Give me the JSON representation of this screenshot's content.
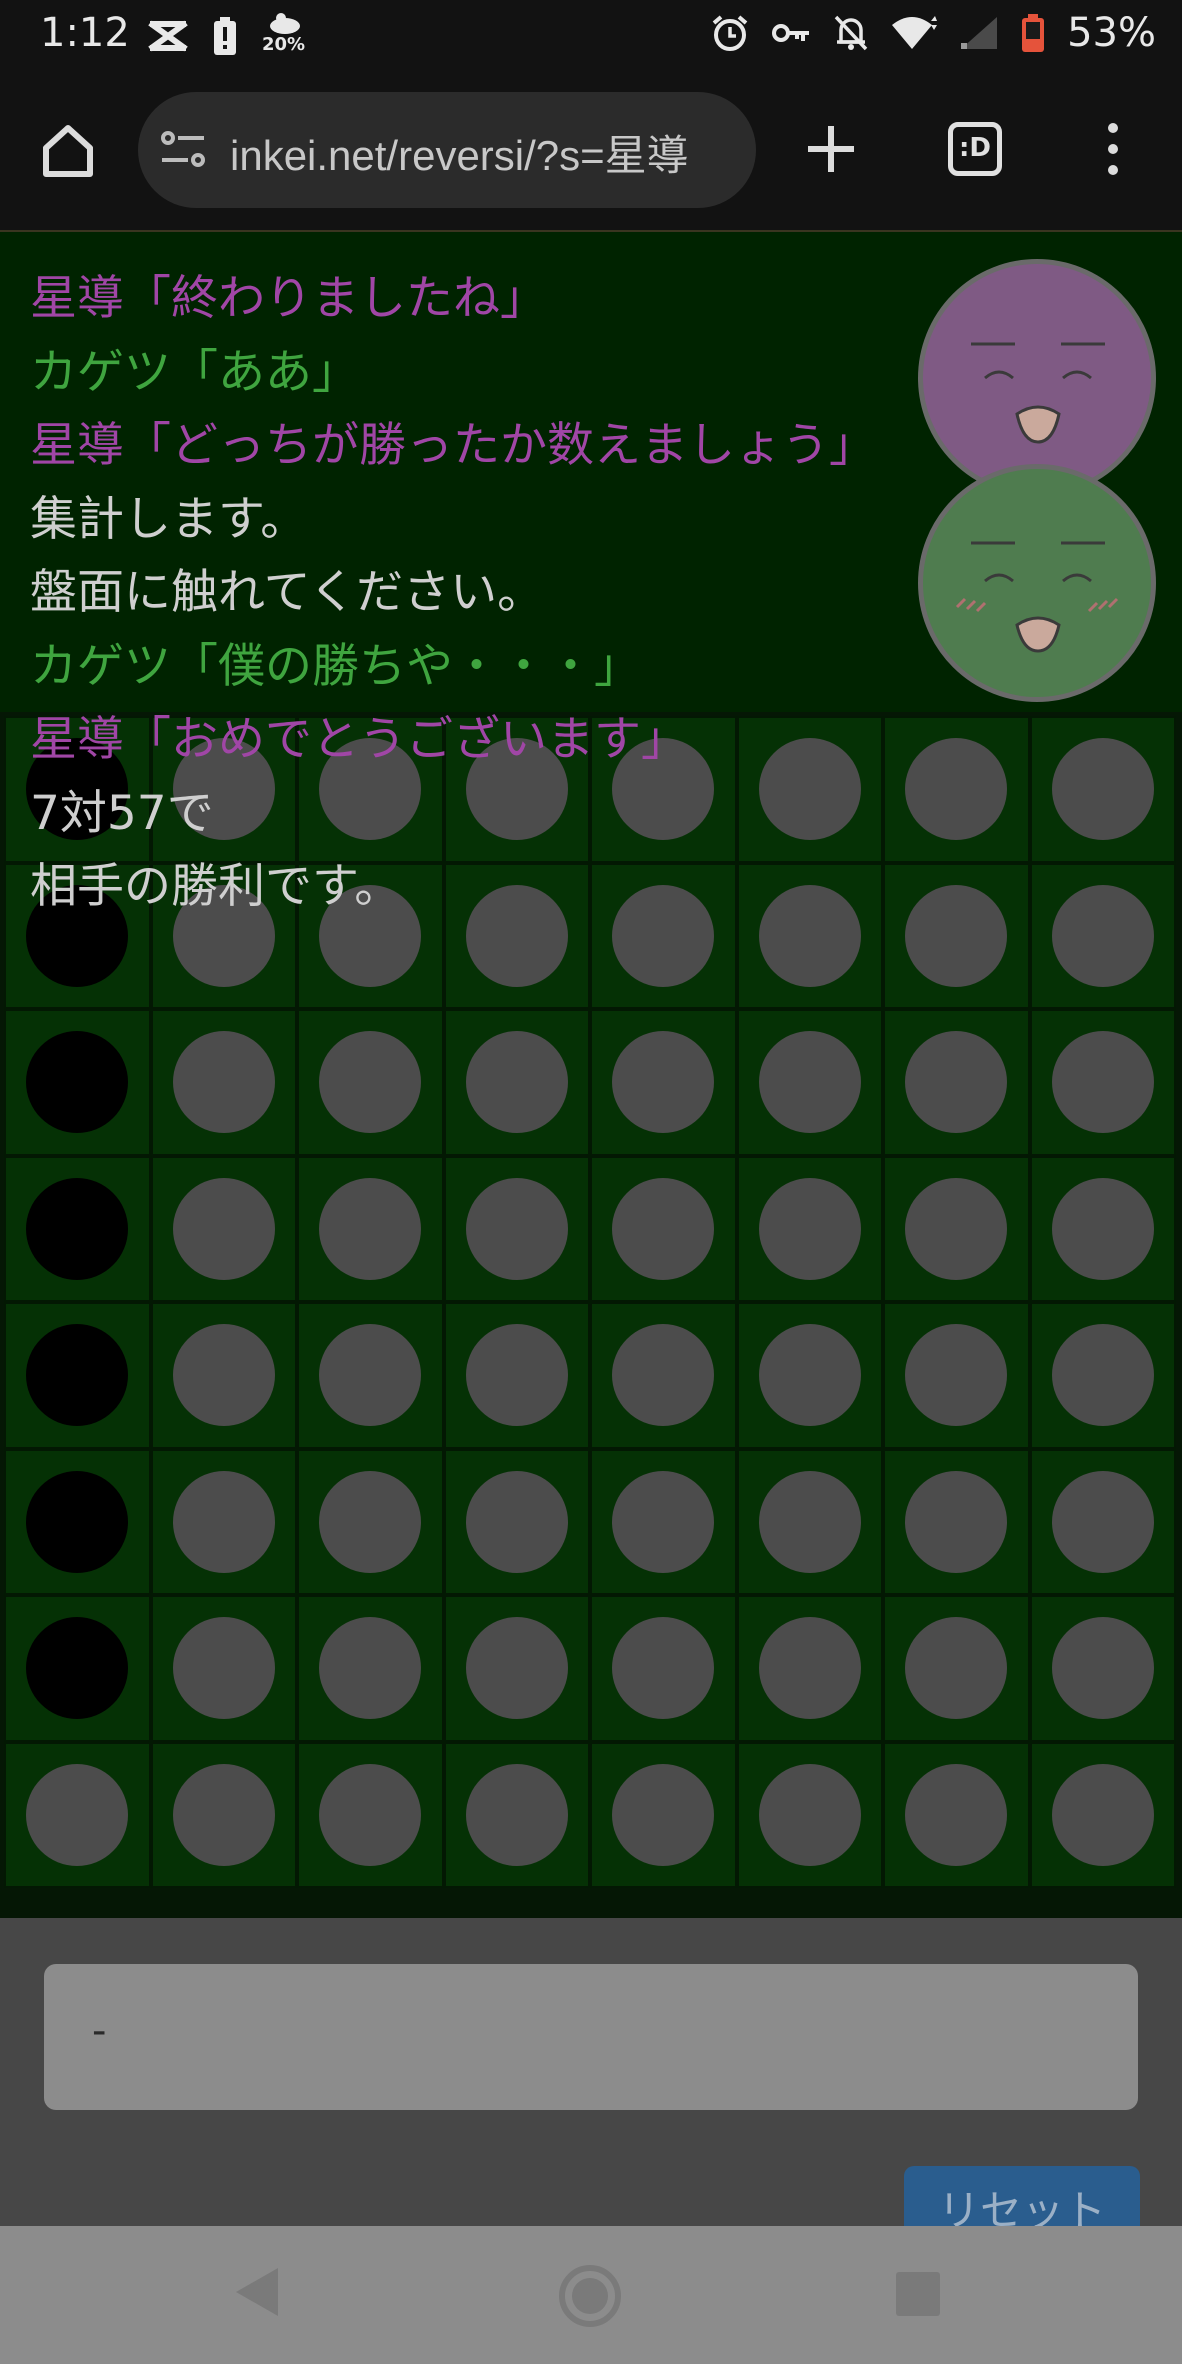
{
  "status_bar": {
    "time": "1:12",
    "data_saver_value": "20%",
    "battery": "53%",
    "icons": [
      "cast-icon",
      "battery-alert-icon",
      "data-saver-icon",
      "alarm-icon",
      "key-icon",
      "bell-off-icon",
      "wifi-icon",
      "signal-icon",
      "battery-icon"
    ]
  },
  "browser": {
    "url": "inkei.net/reversi/?s=星導",
    "tab_switch_label": ":D"
  },
  "chat": {
    "lines": [
      {
        "text": "星導「終わりましたね」",
        "color": "#a046a6"
      },
      {
        "text": "カゲツ「ああ」",
        "color": "#3fa53f"
      },
      {
        "text": "星導「どっちが勝ったか数えましょう」",
        "color": "#a046a6"
      },
      {
        "text": "集計します。",
        "color": "#cfcfcf"
      },
      {
        "text": "盤面に触れてください。",
        "color": "#cfcfcf"
      },
      {
        "text": "カゲツ「僕の勝ちや・・・」",
        "color": "#3fa53f"
      },
      {
        "text": "星導「おめでとうございます」",
        "color": "#a046a6"
      },
      {
        "text": "7対57で",
        "color": "#cfcfcf"
      },
      {
        "text": "相手の勝利です。",
        "color": "#cfcfcf"
      }
    ]
  },
  "board": {
    "size": 8,
    "rows": [
      "BWWWWWWW",
      "BWWWWWWW",
      "BWWWWWWW",
      "BWWWWWWW",
      "BWWWWWWW",
      "BWWWWWWW",
      "BWWWWWWW",
      "WWWWWWWW"
    ],
    "colors": {
      "board": "#0a5a0a",
      "white": "#8a8a8a",
      "black": "#000000"
    }
  },
  "result_box": {
    "text": "-"
  },
  "reset_button": {
    "label": "リセット"
  }
}
